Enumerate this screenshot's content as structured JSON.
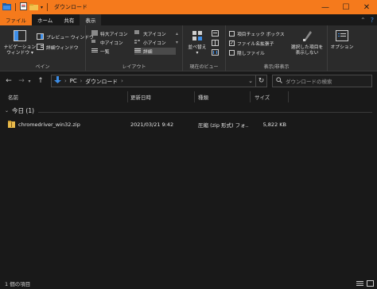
{
  "window": {
    "title": "ダウンロード",
    "controls": {
      "minimize": "—",
      "maximize": "☐",
      "close": "✕"
    }
  },
  "ribbon_tabs": [
    "ファイル",
    "ホーム",
    "共有",
    "表示"
  ],
  "ribbon": {
    "pane": {
      "label": "ペイン",
      "navigation_pane": "ナビゲーション\nウィンドウ ▾",
      "preview_pane": "プレビュー ウィンドウ",
      "details_pane": "詳細ウィンドウ"
    },
    "layout": {
      "label": "レイアウト",
      "items": [
        "特大アイコン",
        "大アイコン",
        "中アイコン",
        "小アイコン",
        "一覧",
        "詳細"
      ],
      "selected": "詳細"
    },
    "current_view": {
      "label": "現在のビュー",
      "sort_by": "並べ替え\n▾"
    },
    "show_hide": {
      "label": "表示/非表示",
      "item_checkboxes": {
        "label": "項目チェック ボックス",
        "checked": false
      },
      "file_extensions": {
        "label": "ファイル名拡張子",
        "checked": true
      },
      "hidden_items": {
        "label": "隠しファイル",
        "checked": false
      },
      "hide_selected": "選択した項目を\n表示しない"
    },
    "options": {
      "label": "オプション"
    }
  },
  "address": {
    "path": [
      "PC",
      "ダウンロード"
    ],
    "search_placeholder": "ダウンロードの検索"
  },
  "columns": [
    "名前",
    "更新日時",
    "種類",
    "サイズ"
  ],
  "group": {
    "label": "今日 (1)"
  },
  "files": [
    {
      "name": "chromedriver_win32.zip",
      "modified": "2021/03/21 9:42",
      "type": "圧縮 (zip 形式) フォ...",
      "size": "5,822 KB"
    }
  ],
  "status": {
    "item_count": "1 個の項目"
  },
  "colors": {
    "accent": "#f57a1c",
    "background": "#191919",
    "ribbon": "#2b2b2b",
    "folder": "#e8b94a"
  }
}
